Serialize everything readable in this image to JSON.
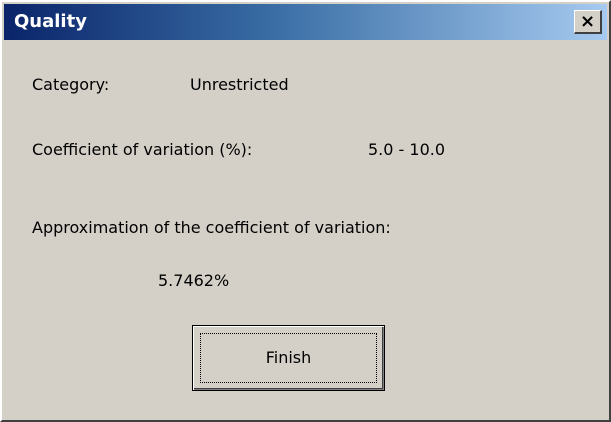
{
  "window": {
    "title": "Quality",
    "close_label": "×"
  },
  "content": {
    "category_label": "Category:",
    "category_value": "Unrestricted",
    "cv_label": "Coefficient of variation (%):",
    "cv_value": "5.0 - 10.0",
    "approx_label": "Approximation of the coefficient of variation:",
    "approx_value": "5.7462%"
  },
  "buttons": {
    "finish_label": "Finish"
  },
  "colors": {
    "titlebar_start": "#0a246a",
    "titlebar_end": "#a6caf0",
    "dialog_bg": "#d4d0c8"
  }
}
